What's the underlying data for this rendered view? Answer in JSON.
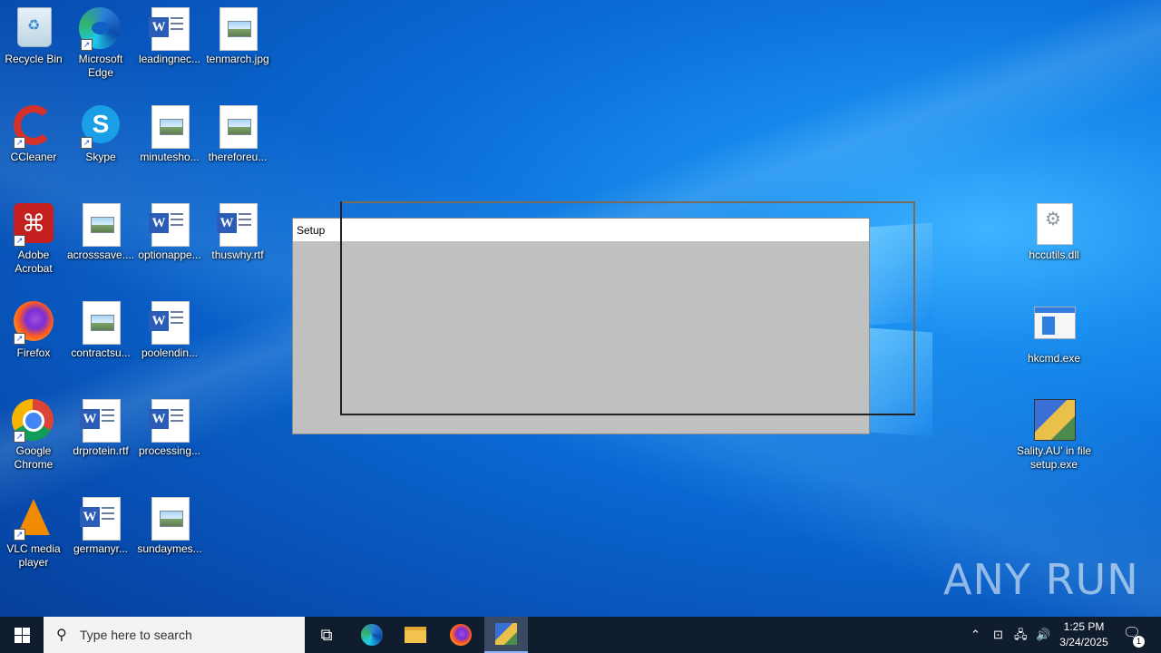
{
  "desktop": {
    "icons": [
      {
        "label": "Recycle Bin"
      },
      {
        "label": "Microsoft Edge"
      },
      {
        "label": "leadingnec..."
      },
      {
        "label": "tenmarch.jpg"
      },
      {
        "label": "CCleaner"
      },
      {
        "label": "Skype"
      },
      {
        "label": "minutesho..."
      },
      {
        "label": "thereforeu..."
      },
      {
        "label": "Adobe Acrobat"
      },
      {
        "label": "acrosssave...."
      },
      {
        "label": "optionappe..."
      },
      {
        "label": "thuswhy.rtf"
      },
      {
        "label": "Firefox"
      },
      {
        "label": "contractsu..."
      },
      {
        "label": "poolendin..."
      },
      {
        "label": "Google Chrome"
      },
      {
        "label": "drprotein.rtf"
      },
      {
        "label": "processing..."
      },
      {
        "label": "VLC media player"
      },
      {
        "label": "germanyr..."
      },
      {
        "label": "sundaymes..."
      },
      {
        "label": "hccutils.dll"
      },
      {
        "label": "hkcmd.exe"
      },
      {
        "label": "Sality.AU' in file setup.exe"
      }
    ]
  },
  "setup_window": {
    "title": "Setup"
  },
  "watermark": "ANY RUN",
  "taskbar": {
    "search_placeholder": "Type here to search",
    "time": "1:25 PM",
    "date": "3/24/2025",
    "notification_count": "1"
  }
}
